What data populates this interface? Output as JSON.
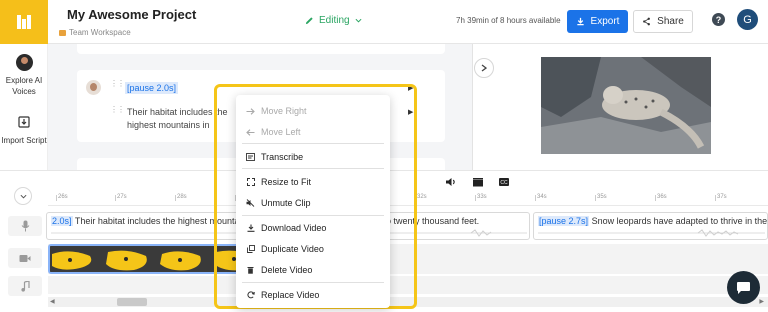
{
  "header": {
    "project_title": "My Awesome Project",
    "workspace": "Team Workspace",
    "editing_label": "Editing",
    "availability": "7h 39min of 8 hours available",
    "export_label": "Export",
    "share_label": "Share",
    "help_glyph": "?",
    "avatar_initial": "G",
    "accent_color": "#1b73e8",
    "brand_color": "#f5bf1a"
  },
  "sidebar": {
    "items": [
      {
        "label": "Explore AI Voices",
        "icon": "voice-avatar-icon"
      },
      {
        "label": "Import Script",
        "icon": "import-icon"
      }
    ]
  },
  "script": {
    "pause_tag": "[pause 2.0s]",
    "text": "Their habitat includes the highest mountains in Central Asia, with altitudes up to twenty thousand feet."
  },
  "timeline": {
    "ticks": [
      "26s",
      "27s",
      "28s",
      "29s",
      "30s",
      "31s",
      "32s",
      "33s",
      "34s",
      "35s",
      "36s",
      "37s"
    ],
    "clip1_pause": "2.0s]",
    "clip1_text": "Their habitat includes the highest mountains in Central Asia, with altitudes up to twenty thousand feet.",
    "clip2_pause": "[pause 2.7s]",
    "clip2_text": "Snow leopards have adapted to thrive in these"
  },
  "context_menu": {
    "items": [
      {
        "label": "Move Right",
        "icon": "arrow-right-icon",
        "disabled": true
      },
      {
        "label": "Move Left",
        "icon": "arrow-left-icon",
        "disabled": true
      },
      {
        "label": "Transcribe",
        "icon": "transcribe-icon",
        "disabled": false
      },
      {
        "label": "Resize to Fit",
        "icon": "resize-icon",
        "disabled": false
      },
      {
        "label": "Unmute Clip",
        "icon": "unmute-icon",
        "disabled": false
      },
      {
        "label": "Download Video",
        "icon": "download-icon",
        "disabled": false
      },
      {
        "label": "Duplicate Video",
        "icon": "duplicate-icon",
        "disabled": false
      },
      {
        "label": "Delete Video",
        "icon": "trash-icon",
        "disabled": false
      },
      {
        "label": "Replace Video",
        "icon": "replace-icon",
        "disabled": false
      }
    ],
    "highlight_color": "#f5c518"
  }
}
